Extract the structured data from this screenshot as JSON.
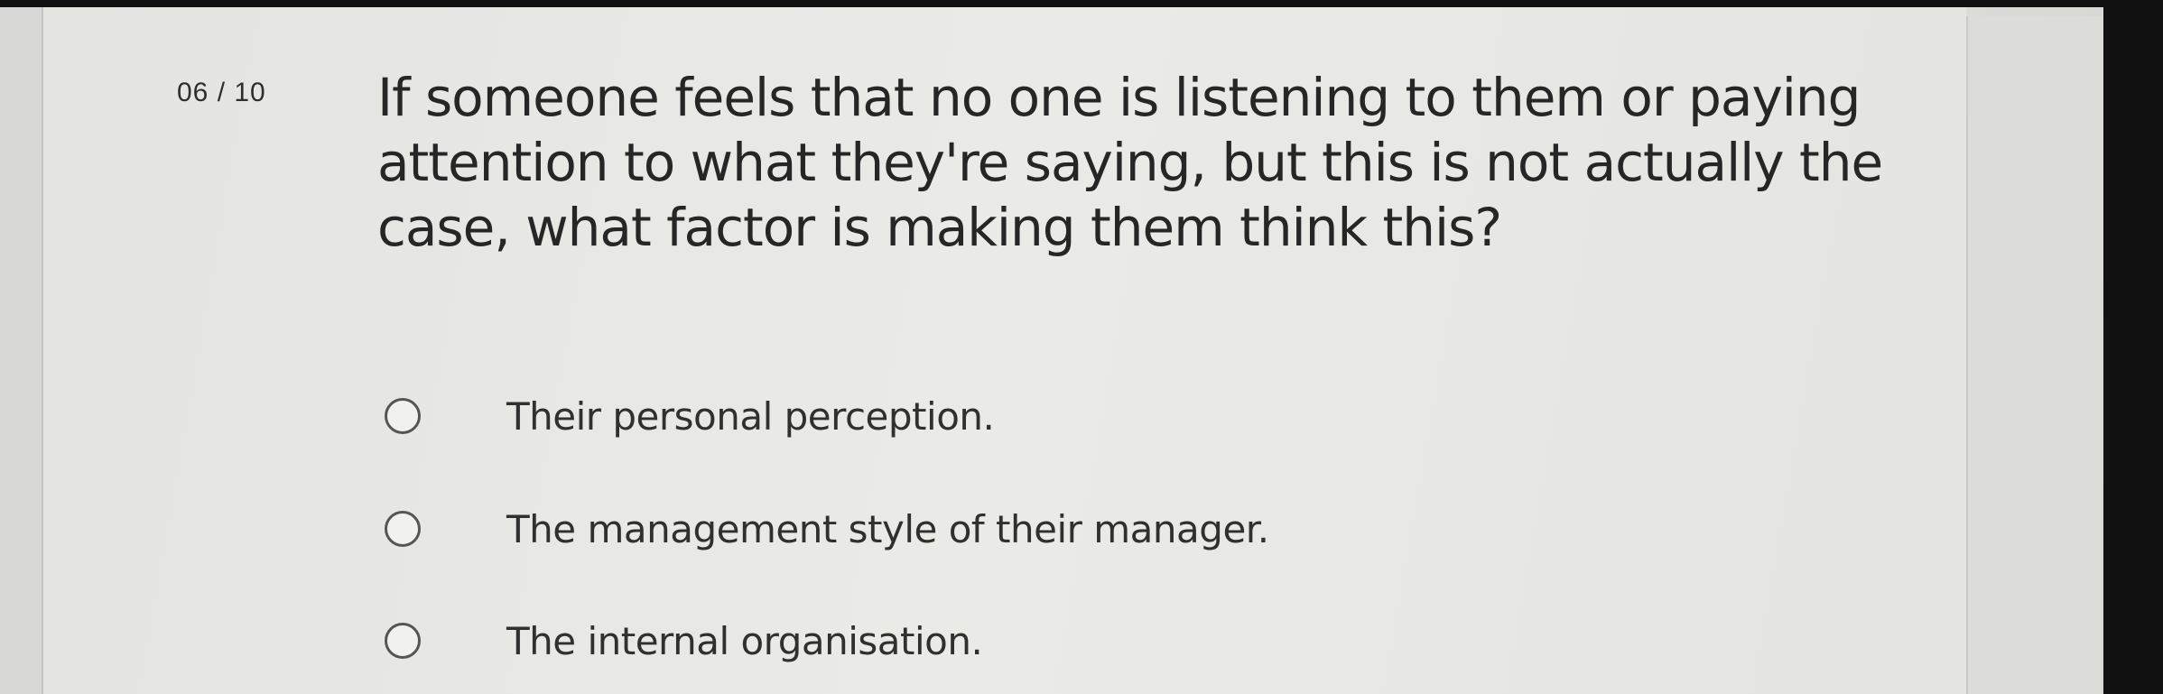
{
  "quiz": {
    "counter": "06 / 10",
    "question": "If someone feels that no one is listening to them or paying attention to what they're saying, but this is not actually the case, what factor is making them think this?",
    "options": [
      {
        "label": "Their personal perception."
      },
      {
        "label": "The management style of their manager."
      },
      {
        "label": "The internal organisation."
      }
    ]
  }
}
